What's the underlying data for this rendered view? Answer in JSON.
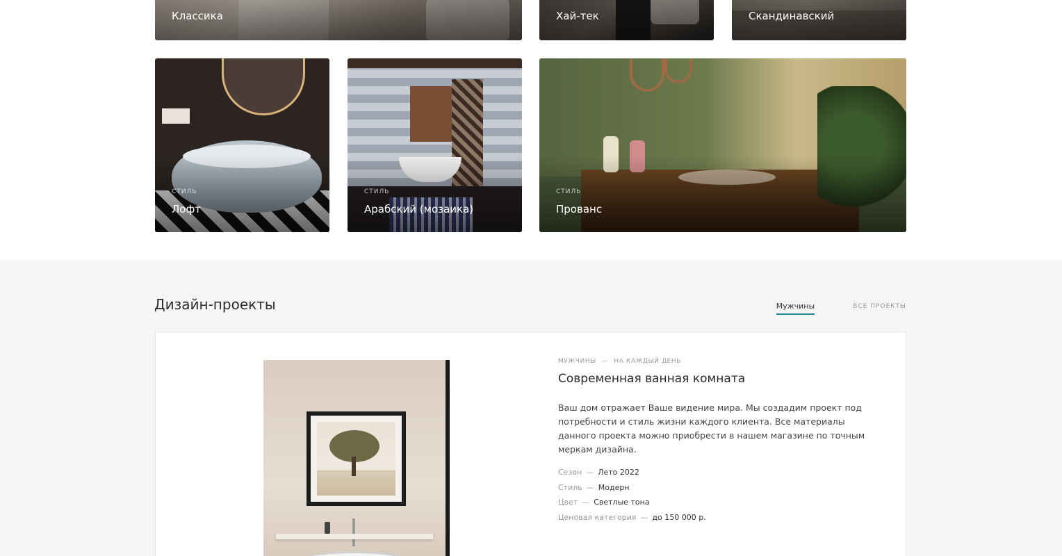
{
  "styles": {
    "kicker": "СТИЛЬ",
    "items": [
      {
        "name": "Классика"
      },
      {
        "name": "Хай-тек"
      },
      {
        "name": "Скандинавский"
      },
      {
        "name": "Лофт"
      },
      {
        "name": "Арабский (мозаика)"
      },
      {
        "name": "Прованс"
      }
    ]
  },
  "projects": {
    "title": "Дизайн-проекты",
    "tabs": [
      {
        "label": "Мужчины",
        "active": true
      },
      {
        "label": "ВСЕ ПРОЕКТЫ",
        "active": false
      }
    ],
    "accent_color": "#1e8a8a",
    "card": {
      "breadcrumb": [
        "МУЖЧИНЫ",
        "—",
        "НА КАЖДЫЙ ДЕНЬ"
      ],
      "title": "Современная ванная комната",
      "description": "Ваш дом отражает Ваше видение мира. Мы создадим проект под потребности и стиль жизни каждого клиента. Все материалы данного проекта можно приобрести в нашем магазине по точным меркам дизайна.",
      "specs": [
        {
          "key": "Сезон",
          "sep": "—",
          "value": "Лето 2022"
        },
        {
          "key": "Стиль",
          "sep": "—",
          "value": "Модерн"
        },
        {
          "key": "Цвет",
          "sep": "—",
          "value": "Светлые тона"
        },
        {
          "key": "Ценовая категория",
          "sep": "—",
          "value": "до 150 000 р."
        }
      ]
    }
  }
}
